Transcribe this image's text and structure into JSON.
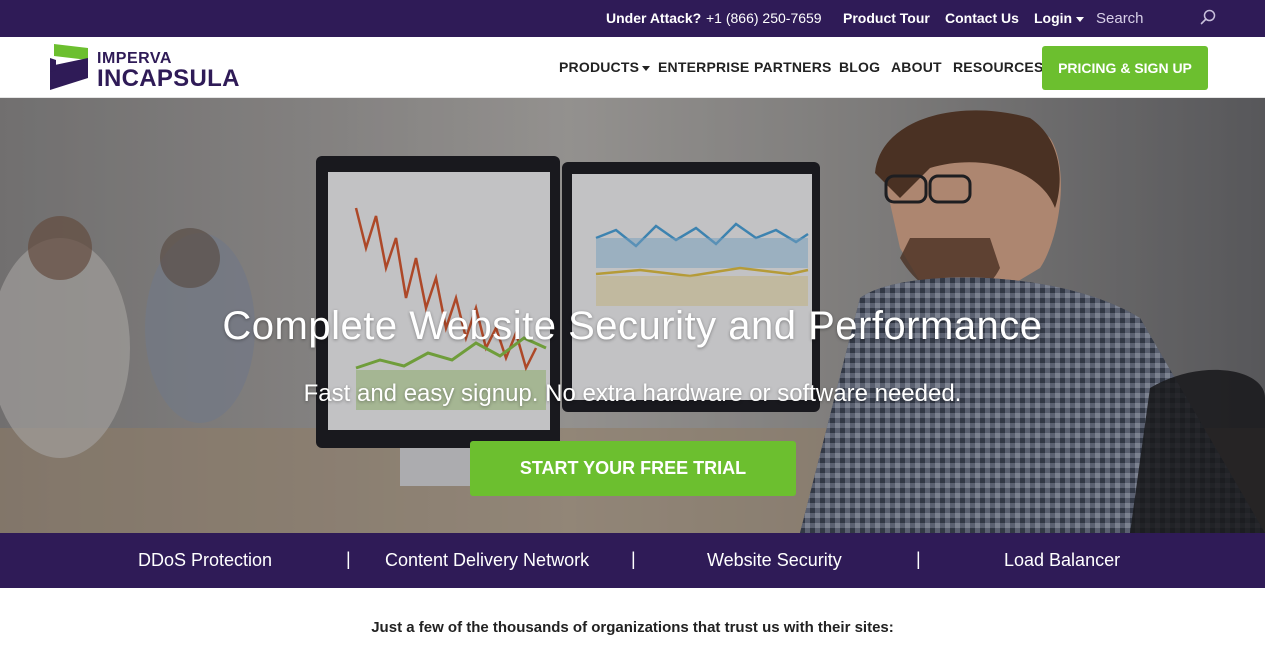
{
  "topbar": {
    "under_attack": "Under Attack?",
    "phone": "+1 (866) 250-7659",
    "product_tour": "Product Tour",
    "contact_us": "Contact Us",
    "login": "Login",
    "search_placeholder": "Search",
    "search_icon": "search-icon"
  },
  "brand": {
    "line1": "IMPERVA",
    "line2": "INCAPSULA",
    "primary_color": "#2f1b57",
    "accent_color": "#6cbf2f"
  },
  "nav": {
    "products": "PRODUCTS",
    "enterprise": "ENTERPRISE",
    "partners": "PARTNERS",
    "blog": "BLOG",
    "about": "ABOUT",
    "resources": "RESOURCES",
    "cta": "PRICING & SIGN UP"
  },
  "hero": {
    "title": "Complete Website Security and Performance",
    "subtitle": "Fast and easy signup. No extra hardware or software needed.",
    "cta": "START YOUR FREE TRIAL"
  },
  "products_strip": {
    "items": [
      "DDoS Protection",
      "Content Delivery Network",
      "Website Security",
      "Load Balancer"
    ],
    "separator": "|"
  },
  "trust": {
    "text": "Just a few of the thousands of organizations that trust us with their sites:"
  }
}
